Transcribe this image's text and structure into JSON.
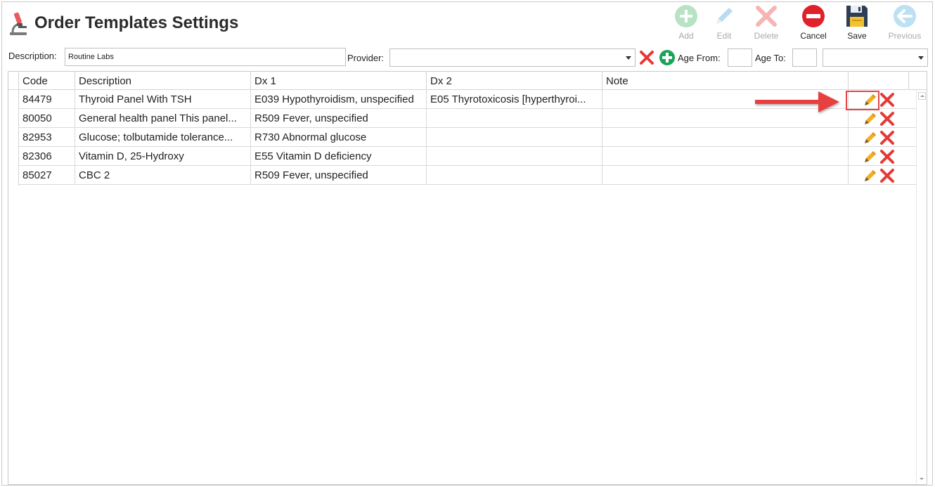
{
  "header": {
    "title": "Order Templates Settings",
    "icon": "microscope-icon"
  },
  "toolbar": {
    "add_label": "Add",
    "edit_label": "Edit",
    "delete_label": "Delete",
    "cancel_label": "Cancel",
    "save_label": "Save",
    "previous_label": "Previous"
  },
  "filters": {
    "description_label": "Description:",
    "description_value": "Routine Labs",
    "provider_label": "Provider:",
    "provider_value": "",
    "age_from_label": "Age From:",
    "age_from_value": "",
    "age_to_label": "Age To:",
    "age_to_value": "",
    "age_unit_value": ""
  },
  "grid": {
    "columns": [
      "Code",
      "Description",
      "Dx 1",
      "Dx 2",
      "Note"
    ],
    "rows": [
      {
        "code": "84479",
        "description": "Thyroid Panel With TSH",
        "dx1": "E039 Hypothyroidism, unspecified",
        "dx2": "E05 Thyrotoxicosis [hyperthyroi...",
        "note": ""
      },
      {
        "code": "80050",
        "description": "General health panel This panel...",
        "dx1": "R509 Fever, unspecified",
        "dx2": "",
        "note": ""
      },
      {
        "code": "82953",
        "description": "Glucose; tolbutamide tolerance...",
        "dx1": "R730 Abnormal glucose",
        "dx2": "",
        "note": ""
      },
      {
        "code": "82306",
        "description": "Vitamin D, 25-Hydroxy",
        "dx1": "E55 Vitamin D deficiency",
        "dx2": "",
        "note": ""
      },
      {
        "code": "85027",
        "description": "CBC 2",
        "dx1": "R509 Fever, unspecified",
        "dx2": "",
        "note": ""
      }
    ]
  },
  "colors": {
    "accent_green": "#1aa35a",
    "delete_red": "#e53935",
    "pencil_yellow": "#f2b01e",
    "annotation_red": "#e34545"
  }
}
